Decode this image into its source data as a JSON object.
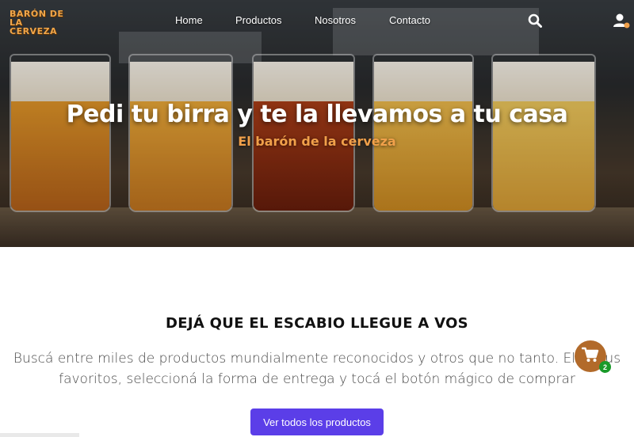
{
  "brand": {
    "logo_line1": "BARÓN DE LA",
    "logo_line2": "CERVEZA",
    "accent_color": "#f0a04a"
  },
  "nav": {
    "items": [
      {
        "label": "Home"
      },
      {
        "label": "Productos"
      },
      {
        "label": "Nosotros"
      },
      {
        "label": "Contacto"
      }
    ],
    "icons": [
      "search-icon",
      "user-icon"
    ]
  },
  "hero": {
    "title": "Pedi tu birra y te la llevamos a tu casa",
    "subtitle": "El barón de la cerveza"
  },
  "section": {
    "title": "DEJÁ QUE EL ESCABIO LLEGUE A VOS",
    "line1": "Buscá entre miles de productos mundialmente reconocidos y otros que no tanto. Elegí tus",
    "line2": "favoritos, seleccioná la forma de entrega y tocá el botón mágico de comprar",
    "button_label": "Ver todos los productos",
    "button_color": "#5b3ee8"
  },
  "cart": {
    "count": "2",
    "icon": "cart-icon",
    "color": "#b26a2a",
    "badge_color": "#1a9a2a"
  }
}
